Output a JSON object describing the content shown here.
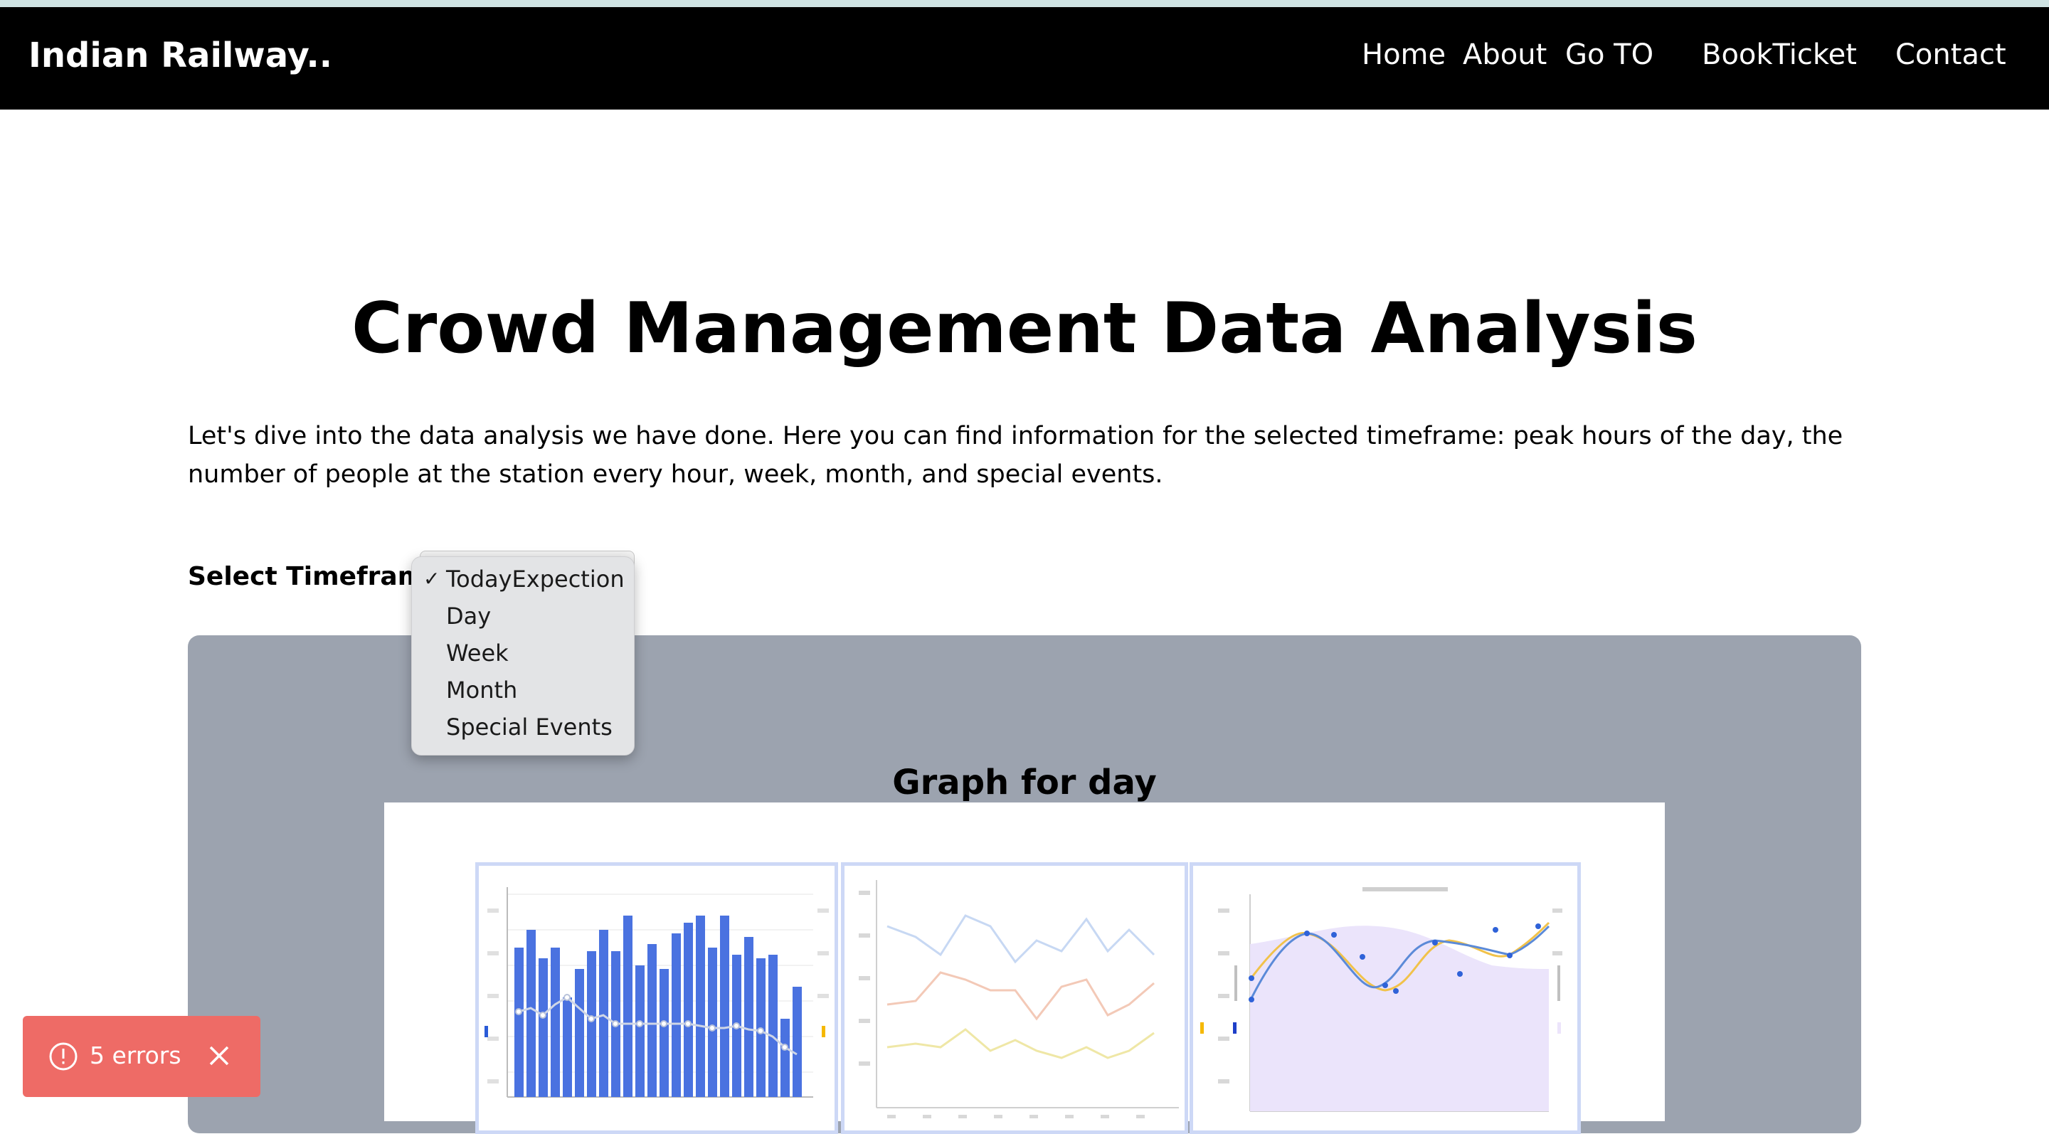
{
  "navbar": {
    "brand": "Indian Railway..",
    "links": [
      "Home",
      "About",
      "Go TO",
      "BookTicket",
      "Contact"
    ]
  },
  "main": {
    "title": "Crowd Management Data Analysis",
    "intro": "Let's dive into the data analysis we have done. Here you can find information for the selected timeframe: peak hours of the day, the number of people at the station every hour, week, month, and special events."
  },
  "timeframe": {
    "label": "Select Timeframe",
    "selected": "TodayExpection",
    "options": [
      "TodayExpection",
      "Day",
      "Week",
      "Month",
      "Special Events"
    ]
  },
  "graph_panel": {
    "title": "Graph for day"
  },
  "error_toast": {
    "text": "5 errors"
  },
  "icons": {
    "check": "checkmark-icon",
    "alert": "alert-circle-icon",
    "close": "close-icon"
  },
  "colors": {
    "navbar_bg": "#000000",
    "panel_bg": "#9ca3af",
    "toast_bg": "#ee6b66",
    "bar_blue": "#4169e1"
  }
}
